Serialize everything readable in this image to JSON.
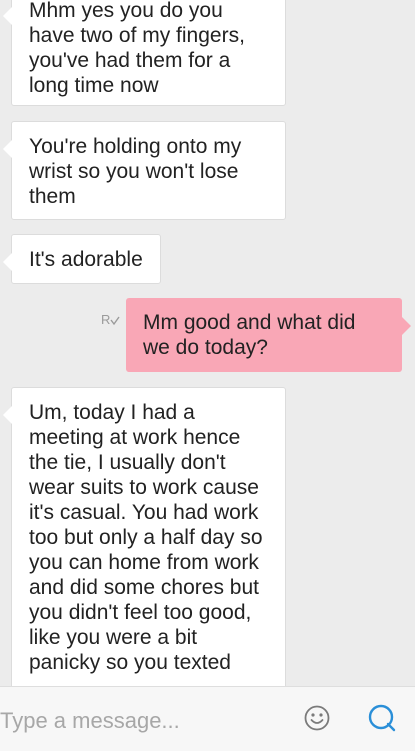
{
  "messages": [
    {
      "side": "in",
      "text": "Mhm yes you do you\nhave two of my fingers,\nyou've had them for a\nlong time now"
    },
    {
      "side": "in",
      "text": "You're holding onto my\nwrist so you won't lose\nthem"
    },
    {
      "side": "in",
      "text": "It's adorable"
    },
    {
      "side": "out",
      "text": "Mm good and what did\nwe do today?"
    },
    {
      "side": "in",
      "text": "Um, today I had a\nmeeting at work hence\nthe tie, I usually don't\nwear suits to work cause\nit's casual. You had work\ntoo but only a half day so\nyou can home from work\nand did some chores but\nyou didn't feel too good,\nlike you were a bit\npanicky so you texted"
    }
  ],
  "read_receipt": "R",
  "composer": {
    "placeholder": "Type a message..."
  },
  "icons": {
    "emoji": "smiley-face-icon",
    "send": "send-bubble-icon"
  },
  "colors": {
    "incoming_bubble": "#ffffff",
    "outgoing_bubble": "#f9a7b6",
    "accent": "#2a8fd8",
    "background": "#ececec"
  }
}
